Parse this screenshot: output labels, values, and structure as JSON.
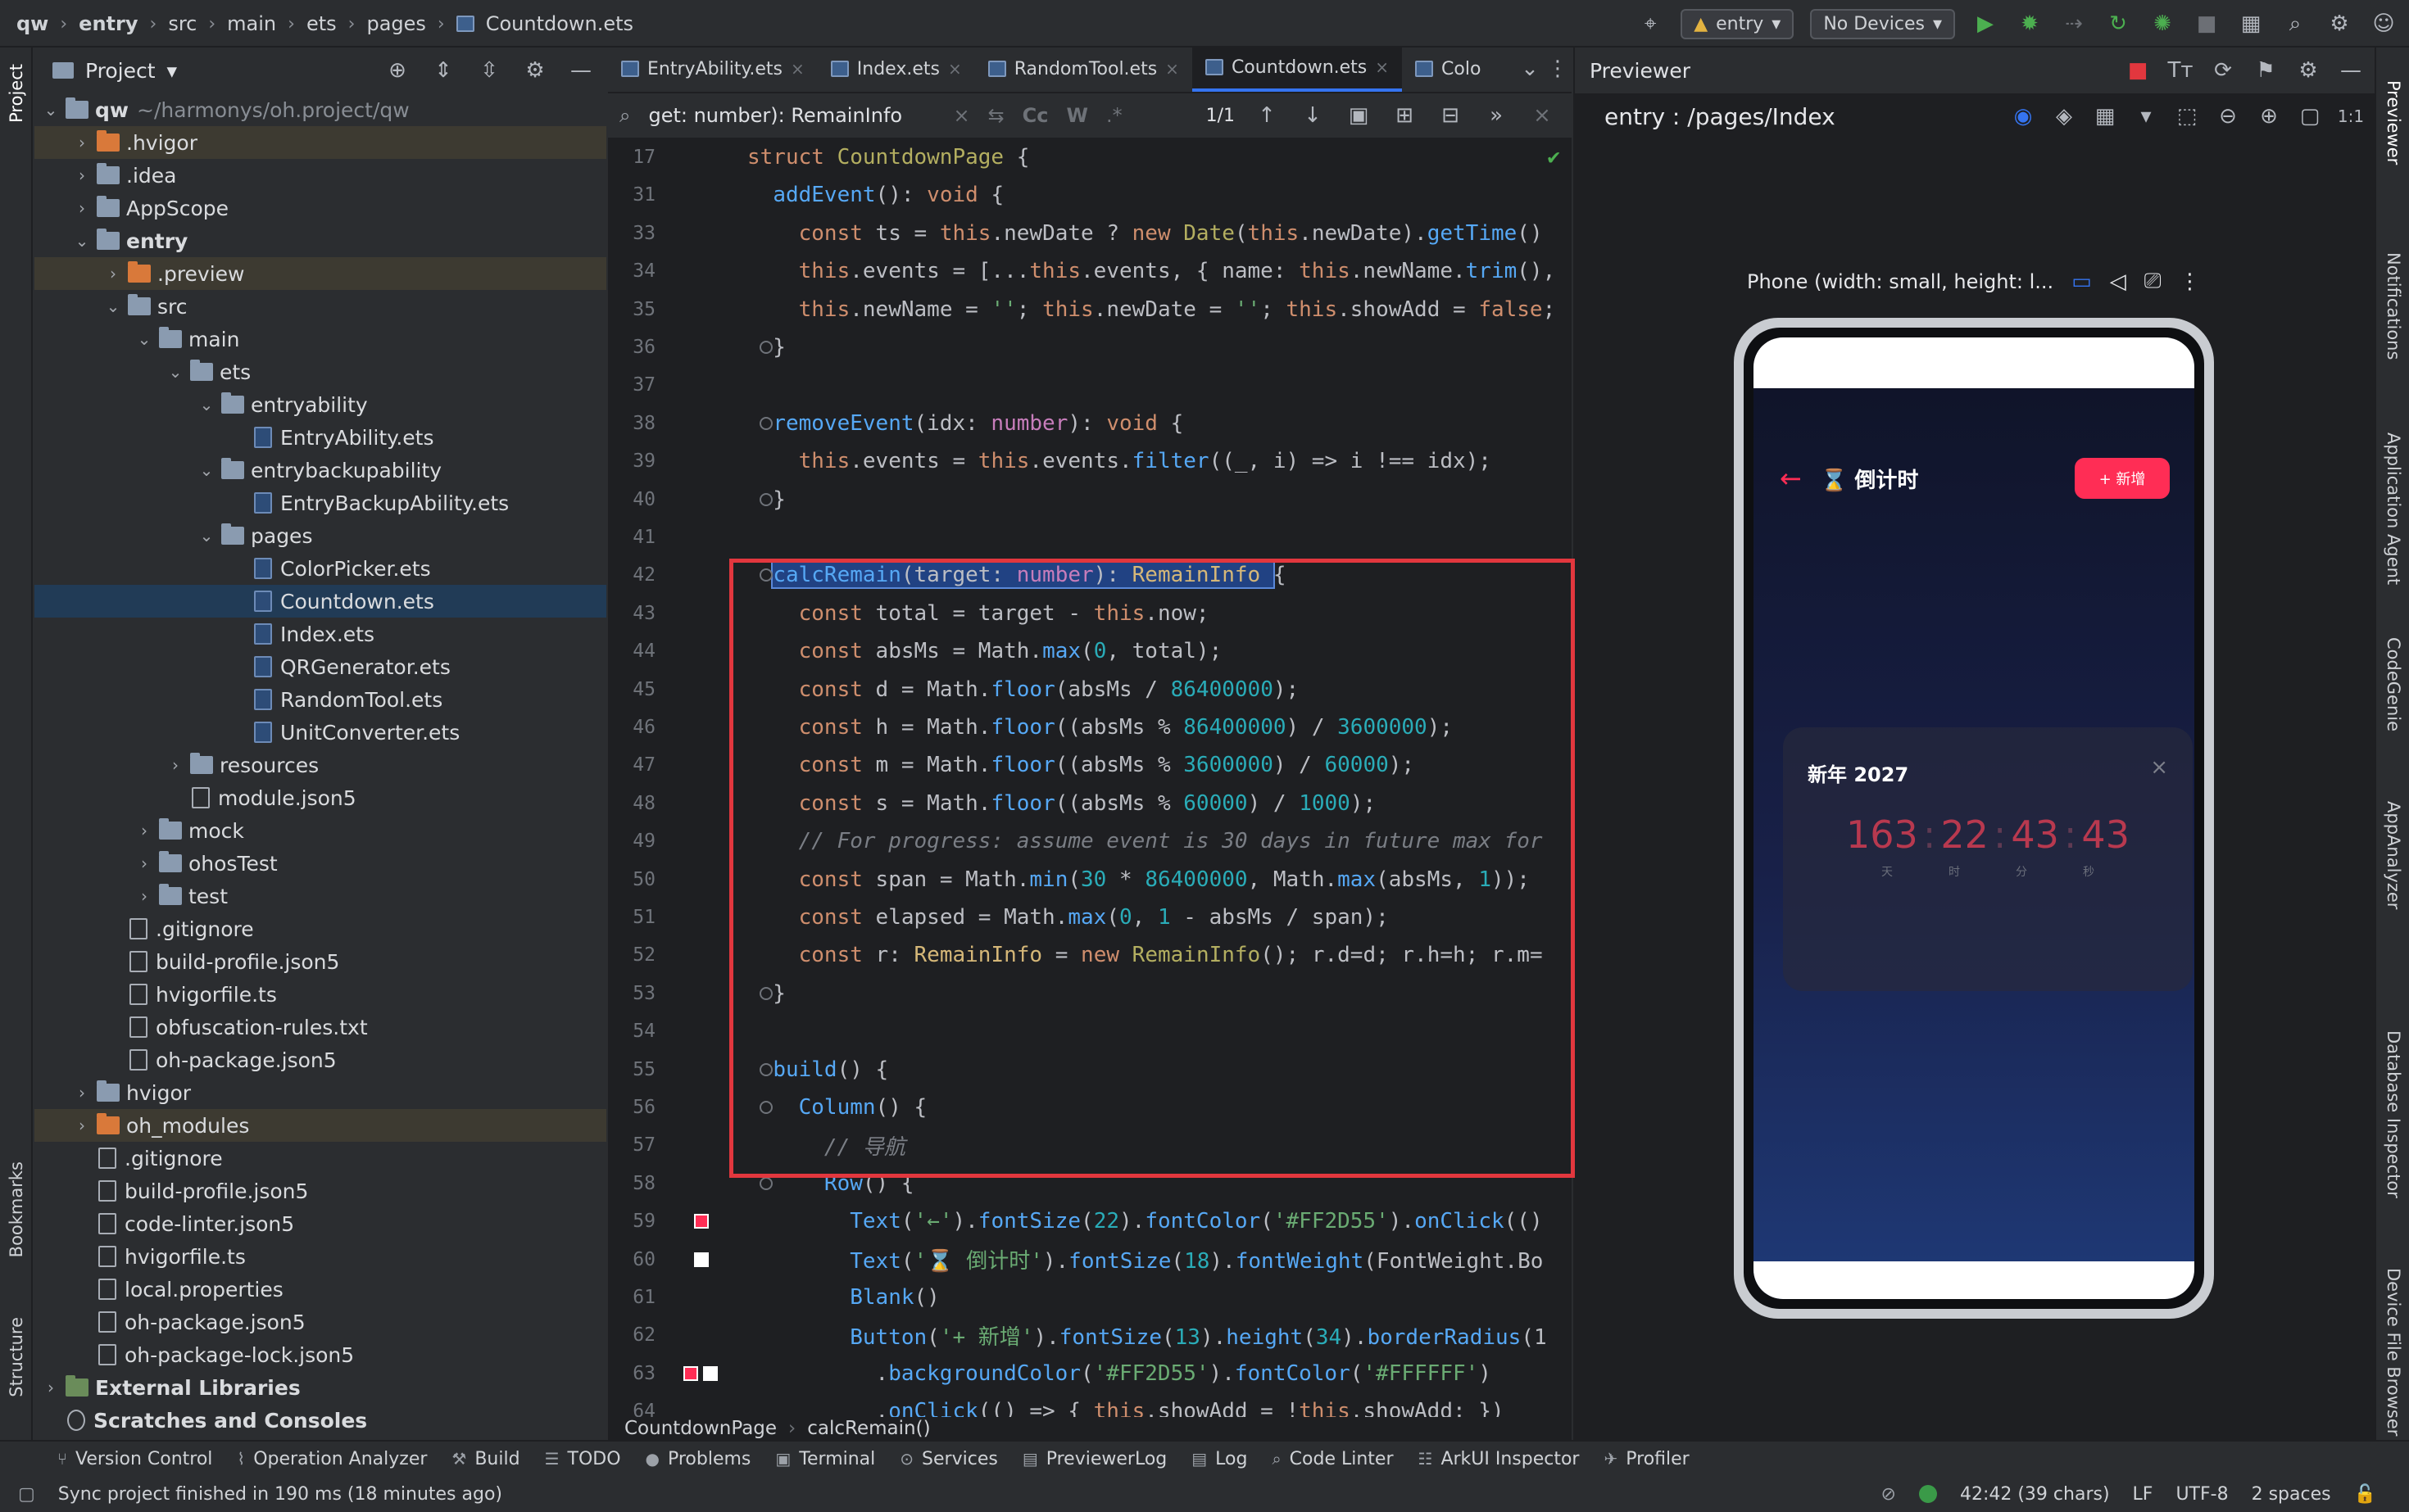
{
  "titlebar": {
    "crumbs": [
      "qw",
      "entry",
      "src",
      "main",
      "ets",
      "pages",
      "Countdown.ets"
    ],
    "run_config": "entry",
    "device": "No Devices"
  },
  "left_strip": {
    "project_label": "Project",
    "bookmarks_label": "Bookmarks",
    "structure_label": "Structure"
  },
  "project_panel": {
    "title": "Project",
    "tree": [
      {
        "label": "qw",
        "extra": "~/harmonys/oh.project/qw",
        "depth": 0,
        "kind": "folder",
        "arrow": "open"
      },
      {
        "label": ".hvigor",
        "depth": 1,
        "kind": "folder-orange",
        "arrow": "closed",
        "hl": true
      },
      {
        "label": ".idea",
        "depth": 1,
        "kind": "folder",
        "arrow": "closed"
      },
      {
        "label": "AppScope",
        "depth": 1,
        "kind": "folder",
        "arrow": "closed"
      },
      {
        "label": "entry",
        "depth": 1,
        "kind": "folder",
        "arrow": "open",
        "bold": true
      },
      {
        "label": ".preview",
        "depth": 2,
        "kind": "folder-orange",
        "arrow": "closed",
        "hl": true
      },
      {
        "label": "src",
        "depth": 2,
        "kind": "folder",
        "arrow": "open"
      },
      {
        "label": "main",
        "depth": 3,
        "kind": "folder",
        "arrow": "open"
      },
      {
        "label": "ets",
        "depth": 4,
        "kind": "folder",
        "arrow": "open"
      },
      {
        "label": "entryability",
        "depth": 5,
        "kind": "folder",
        "arrow": "open"
      },
      {
        "label": "EntryAbility.ets",
        "depth": 6,
        "kind": "ets"
      },
      {
        "label": "entrybackupability",
        "depth": 5,
        "kind": "folder",
        "arrow": "open"
      },
      {
        "label": "EntryBackupAbility.ets",
        "depth": 6,
        "kind": "ets"
      },
      {
        "label": "pages",
        "depth": 5,
        "kind": "folder",
        "arrow": "open"
      },
      {
        "label": "ColorPicker.ets",
        "depth": 6,
        "kind": "ets"
      },
      {
        "label": "Countdown.ets",
        "depth": 6,
        "kind": "ets",
        "sel": true
      },
      {
        "label": "Index.ets",
        "depth": 6,
        "kind": "ets"
      },
      {
        "label": "QRGenerator.ets",
        "depth": 6,
        "kind": "ets"
      },
      {
        "label": "RandomTool.ets",
        "depth": 6,
        "kind": "ets"
      },
      {
        "label": "UnitConverter.ets",
        "depth": 6,
        "kind": "ets"
      },
      {
        "label": "resources",
        "depth": 4,
        "kind": "folder",
        "arrow": "closed"
      },
      {
        "label": "module.json5",
        "depth": 4,
        "kind": "file"
      },
      {
        "label": "mock",
        "depth": 3,
        "kind": "folder",
        "arrow": "closed"
      },
      {
        "label": "ohosTest",
        "depth": 3,
        "kind": "folder",
        "arrow": "closed"
      },
      {
        "label": "test",
        "depth": 3,
        "kind": "folder",
        "arrow": "closed"
      },
      {
        "label": ".gitignore",
        "depth": 2,
        "kind": "file"
      },
      {
        "label": "build-profile.json5",
        "depth": 2,
        "kind": "file"
      },
      {
        "label": "hvigorfile.ts",
        "depth": 2,
        "kind": "file"
      },
      {
        "label": "obfuscation-rules.txt",
        "depth": 2,
        "kind": "file"
      },
      {
        "label": "oh-package.json5",
        "depth": 2,
        "kind": "file"
      },
      {
        "label": "hvigor",
        "depth": 1,
        "kind": "folder",
        "arrow": "closed"
      },
      {
        "label": "oh_modules",
        "depth": 1,
        "kind": "folder-orange",
        "arrow": "closed",
        "hl": true
      },
      {
        "label": ".gitignore",
        "depth": 1,
        "kind": "file"
      },
      {
        "label": "build-profile.json5",
        "depth": 1,
        "kind": "file"
      },
      {
        "label": "code-linter.json5",
        "depth": 1,
        "kind": "file"
      },
      {
        "label": "hvigorfile.ts",
        "depth": 1,
        "kind": "file"
      },
      {
        "label": "local.properties",
        "depth": 1,
        "kind": "file"
      },
      {
        "label": "oh-package.json5",
        "depth": 1,
        "kind": "file"
      },
      {
        "label": "oh-package-lock.json5",
        "depth": 1,
        "kind": "file"
      },
      {
        "label": "External Libraries",
        "depth": 0,
        "kind": "lib",
        "arrow": "closed"
      },
      {
        "label": "Scratches and Consoles",
        "depth": 0,
        "kind": "scratch"
      }
    ]
  },
  "editor": {
    "tabs": [
      {
        "label": "EntryAbility.ets"
      },
      {
        "label": "Index.ets"
      },
      {
        "label": "RandomTool.ets"
      },
      {
        "label": "Countdown.ets",
        "active": true
      },
      {
        "label": "Colo"
      }
    ],
    "find": {
      "query": "get: number): RemainInfo",
      "match_case": "Cc",
      "words": "W",
      "regex": ".*",
      "count": "1/1"
    },
    "lines": [
      {
        "n": "17",
        "html": "<span class='k'>struct</span> <span class='cls'>CountdownPage</span> {"
      },
      {
        "n": "31",
        "html": "  <span class='f'>addEvent</span>(): <span class='k'>void</span> {"
      },
      {
        "n": "33",
        "html": "    <span class='k'>const</span> ts = <span class='k'>this</span>.newDate ? <span class='k'>new</span> <span class='cls'>Date</span>(<span class='k'>this</span>.newDate).<span class='f'>getTime</span>()"
      },
      {
        "n": "34",
        "html": "    <span class='k'>this</span>.events = [...<span class='k'>this</span>.events, { name: <span class='k'>this</span>.newName.<span class='f'>trim</span>(),"
      },
      {
        "n": "35",
        "html": "    <span class='k'>this</span>.newName = <span class='s'>''</span>; <span class='k'>this</span>.newDate = <span class='s'>''</span>; <span class='k'>this</span>.showAdd = <span class='k'>false</span>;"
      },
      {
        "n": "36",
        "html": "  }"
      },
      {
        "n": "37",
        "html": ""
      },
      {
        "n": "38",
        "html": "  <span class='f'>removeEvent</span>(idx: <span class='ty'>number</span>): <span class='k'>void</span> {"
      },
      {
        "n": "39",
        "html": "    <span class='k'>this</span>.events = <span class='k'>this</span>.events.<span class='f'>filter</span>((_, i) => i !== idx);"
      },
      {
        "n": "40",
        "html": "  }"
      },
      {
        "n": "41",
        "html": ""
      },
      {
        "n": "42",
        "html": "  <span style='background:#214283;outline:2px solid #5a88d8'><span class='f'>calcRemain</span>(target: <span class='ty'>number</span>): <span class='ra'>RemainInfo</span> </span>{"
      },
      {
        "n": "43",
        "html": "    <span class='k'>const</span> total = target - <span class='k'>this</span>.now;"
      },
      {
        "n": "44",
        "html": "    <span class='k'>const</span> absMs = Math.<span class='f'>max</span>(<span class='t'>0</span>, total);"
      },
      {
        "n": "45",
        "html": "    <span class='k'>const</span> d = Math.<span class='f'>floor</span>(absMs / <span class='t'>86400000</span>);"
      },
      {
        "n": "46",
        "html": "    <span class='k'>const</span> h = Math.<span class='f'>floor</span>((absMs % <span class='t'>86400000</span>) / <span class='t'>3600000</span>);"
      },
      {
        "n": "47",
        "html": "    <span class='k'>const</span> m = Math.<span class='f'>floor</span>((absMs % <span class='t'>3600000</span>) / <span class='t'>60000</span>);"
      },
      {
        "n": "48",
        "html": "    <span class='k'>const</span> s = Math.<span class='f'>floor</span>((absMs % <span class='t'>60000</span>) / <span class='t'>1000</span>);"
      },
      {
        "n": "49",
        "html": "    <span class='c'>// For progress: assume event is 30 days in future max for</span>"
      },
      {
        "n": "50",
        "html": "    <span class='k'>const</span> span = Math.<span class='f'>min</span>(<span class='t'>30</span> * <span class='t'>86400000</span>, Math.<span class='f'>max</span>(absMs, <span class='t'>1</span>));"
      },
      {
        "n": "51",
        "html": "    <span class='k'>const</span> elapsed = Math.<span class='f'>max</span>(<span class='t'>0</span>, <span class='t'>1</span> - absMs / span);"
      },
      {
        "n": "52",
        "html": "    <span class='k'>const</span> r: <span class='ra'>RemainInfo</span> = <span class='k'>new</span> <span class='cls'>RemainInfo</span>(); r.d=d; r.h=h; r.m="
      },
      {
        "n": "53",
        "html": "  }"
      },
      {
        "n": "54",
        "html": ""
      },
      {
        "n": "55",
        "html": "  <span class='f'>build</span>() {"
      },
      {
        "n": "56",
        "html": "    <span class='f'>Column</span>() {"
      },
      {
        "n": "57",
        "html": "      <span class='c'>// 导航</span>"
      },
      {
        "n": "58",
        "html": "      <span class='f'>Row</span>() {"
      },
      {
        "n": "59",
        "html": "        <span class='f'>Text</span>(<span class='s'>'←'</span>).<span class='f'>fontSize</span>(<span class='t'>22</span>).<span class='f'>fontColor</span>(<span class='s'>'#FF2D55'</span>).<span class='f'>onClick</span>(()"
      },
      {
        "n": "60",
        "html": "        <span class='f'>Text</span>(<span class='s'>'⌛ 倒计时'</span>).<span class='f'>fontSize</span>(<span class='t'>18</span>).<span class='f'>fontWeight</span>(FontWeight.Bo"
      },
      {
        "n": "61",
        "html": "        <span class='f'>Blank</span>()"
      },
      {
        "n": "62",
        "html": "        <span class='f'>Button</span>(<span class='s'>'+ 新增'</span>).<span class='f'>fontSize</span>(<span class='t'>13</span>).<span class='f'>height</span>(<span class='t'>34</span>).<span class='f'>borderRadius</span>(1"
      },
      {
        "n": "63",
        "html": "          .<span class='f'>backgroundColor</span>(<span class='s'>'#FF2D55'</span>).<span class='f'>fontColor</span>(<span class='s'>'#FFFFFF'</span>)"
      },
      {
        "n": "64",
        "html": "          .<span class='f'>onClick</span>(() => { <span class='k'>this</span>.showAdd = !<span class='k'>this</span>.showAdd; })"
      }
    ],
    "breadcrumb": [
      "CountdownPage",
      "calcRemain()"
    ]
  },
  "previewer": {
    "title": "Previewer",
    "path": "entry : /pages/Index",
    "device_label": "Phone (width: small, height: l...",
    "app": {
      "back": "←",
      "title": "⌛ 倒计时",
      "add_button": "+ 新增",
      "card_title": "新年 2027",
      "close": "×",
      "time": {
        "d": "163",
        "h": "22",
        "m": "43",
        "s": "43"
      },
      "units": [
        "天",
        "时",
        "分",
        "秒"
      ]
    }
  },
  "right_strip": {
    "items": [
      "Previewer",
      "Notifications",
      "Application Agent",
      "CodeGenie",
      "AppAnalyzer",
      "Database Inspector",
      "Device File Browser"
    ]
  },
  "bottom_tools": [
    "Version Control",
    "Operation Analyzer",
    "Build",
    "TODO",
    "Problems",
    "Terminal",
    "Services",
    "PreviewerLog",
    "Log",
    "Code Linter",
    "ArkUI Inspector",
    "Profiler"
  ],
  "statusbar": {
    "message": "Sync project finished in 190 ms (18 minutes ago)",
    "position": "42:42 (39 chars)",
    "line_sep": "LF",
    "encoding": "UTF-8",
    "indent": "2 spaces"
  }
}
